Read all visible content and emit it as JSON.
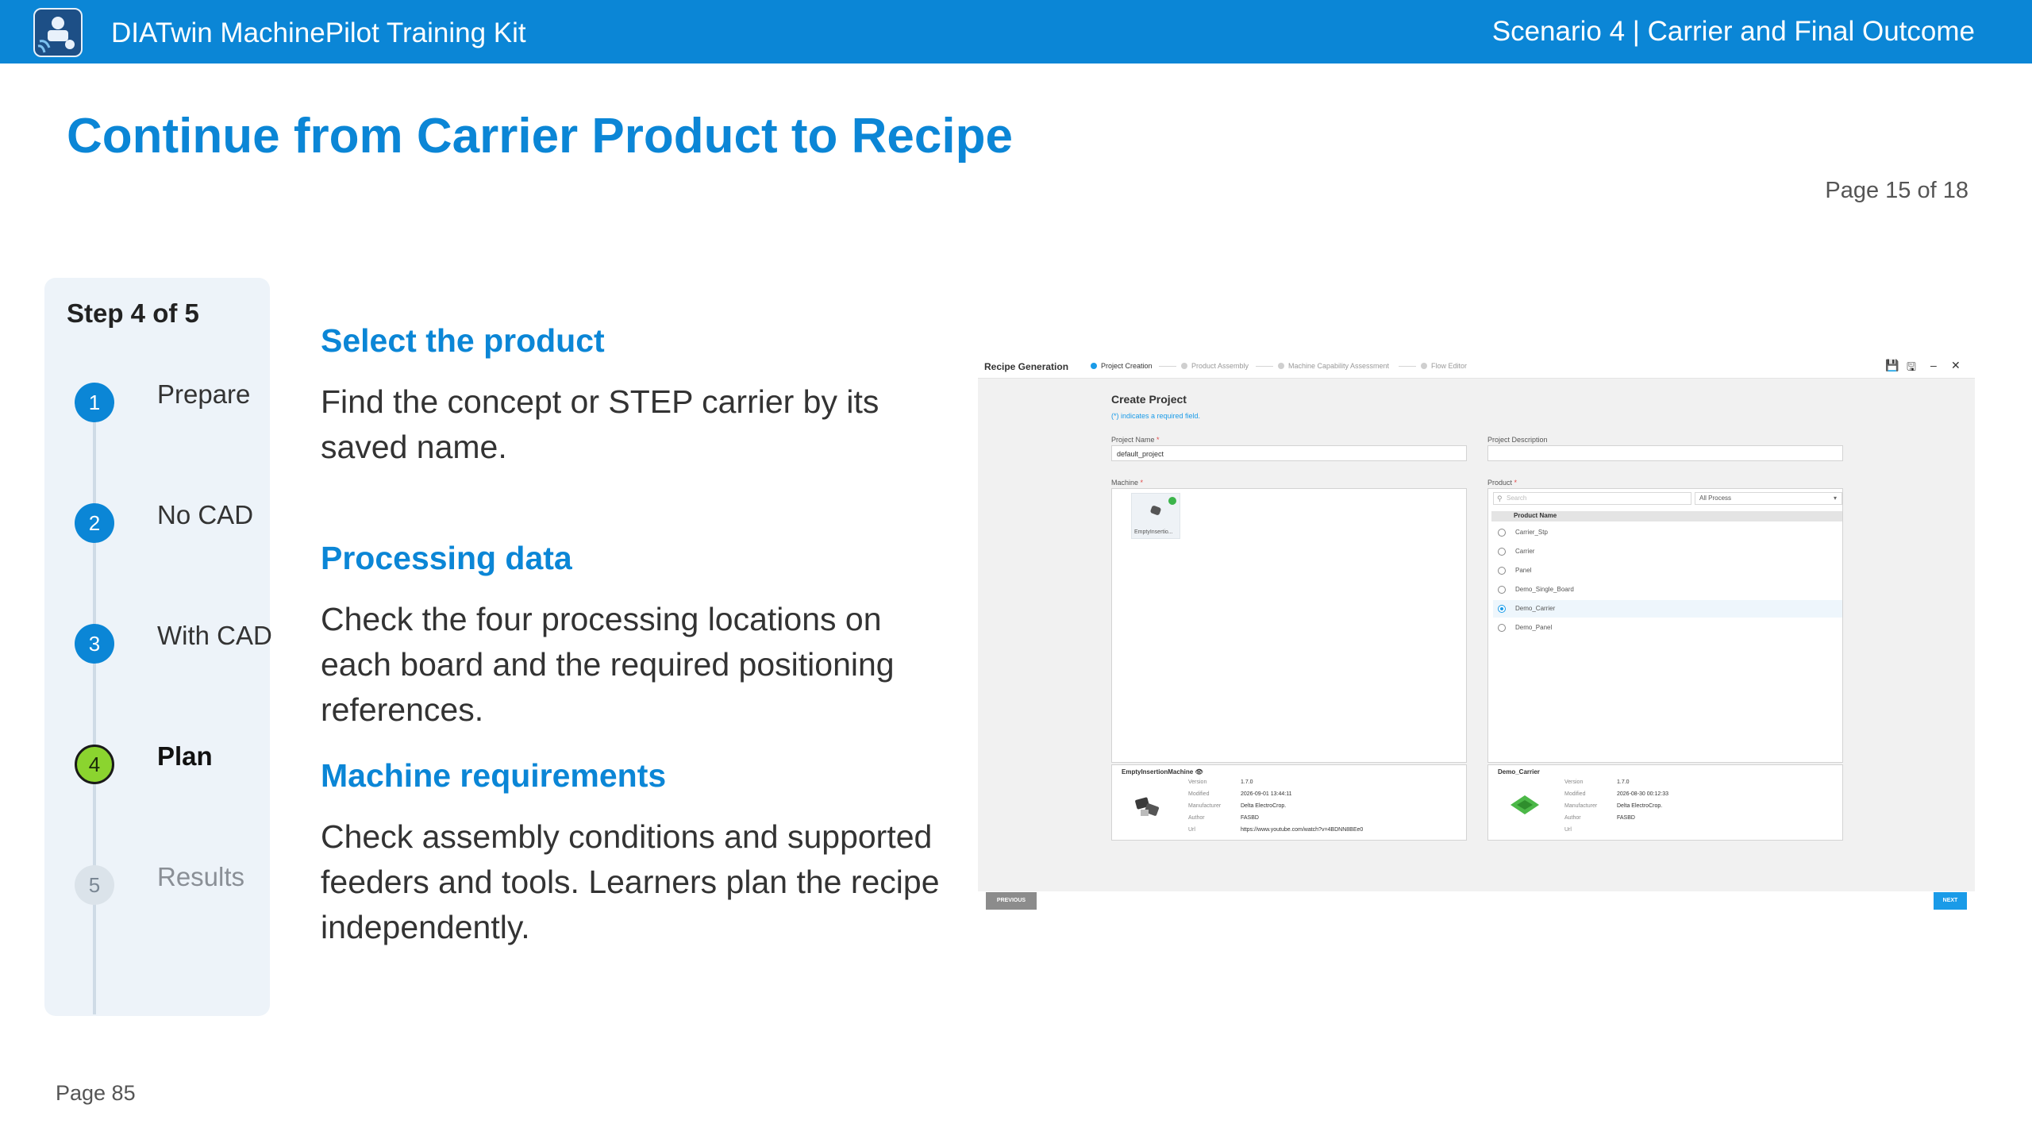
{
  "header": {
    "app_title": "DIATwin MachinePilot Training Kit",
    "scenario": "Scenario 4 | Carrier and Final Outcome"
  },
  "page": {
    "title": "Continue from Carrier Product to Recipe",
    "page_count": "Page 15 of 18",
    "footer_page": "Page 85"
  },
  "stepper": {
    "title": "Step 4 of 5",
    "steps": [
      {
        "num": "1",
        "label": "Prepare",
        "state": "done"
      },
      {
        "num": "2",
        "label": "No CAD",
        "state": "done"
      },
      {
        "num": "3",
        "label": "With CAD",
        "state": "done"
      },
      {
        "num": "4",
        "label": "Plan",
        "state": "current"
      },
      {
        "num": "5",
        "label": "Results",
        "state": "future"
      }
    ]
  },
  "sections": [
    {
      "heading": "Select the product",
      "text": "Find the concept or STEP carrier by its saved name."
    },
    {
      "heading": "Processing data",
      "text": "Check the four processing locations on each board and the required positioning references."
    },
    {
      "heading": "Machine requirements",
      "text": "Check assembly conditions and supported feeders and tools. Learners plan the recipe independently."
    }
  ],
  "screenshot": {
    "header_title": "Recipe Generation",
    "wizard_steps": [
      "Project Creation",
      "Product Assembly",
      "Machine Capability Assessment",
      "Flow Editor"
    ],
    "active_wizard_step": 0,
    "create_title": "Create Project",
    "required_note": "(*) indicates a required field.",
    "project_name_label": "Project Name",
    "project_name_value": "default_project",
    "project_desc_label": "Project Description",
    "machine_label": "Machine",
    "product_label": "Product",
    "machine_tile_name": "EmptyInsertio...",
    "search_placeholder": "Search",
    "process_filter": "All Process",
    "product_list_header": "Product Name",
    "products": [
      "Carrier_Stp",
      "Carrier",
      "Panel",
      "Demo_Single_Board",
      "Demo_Carrier",
      "Demo_Panel"
    ],
    "selected_product": "Demo_Carrier",
    "machine_info": {
      "name": "EmptyInsertionMachine",
      "version_label": "Version",
      "version": "1.7.0",
      "modified_label": "Modified",
      "modified": "2026-09-01 13:44:11",
      "manufacturer_label": "Manufacturer",
      "manufacturer": "Delta ElectroCrop.",
      "author_label": "Author",
      "author": "FASBD",
      "url_label": "Url",
      "url": "https://www.youtube.com/watch?v=4BDNN8BEe0"
    },
    "product_info": {
      "name": "Demo_Carrier",
      "version_label": "Version",
      "version": "1.7.0",
      "modified_label": "Modified",
      "modified": "2026-08-30 00:12:33",
      "manufacturer_label": "Manufacturer",
      "manufacturer": "Delta ElectroCrop.",
      "author_label": "Author",
      "author": "FASBD",
      "url_label": "Url"
    },
    "prev_button": "PREVIOUS",
    "next_button": "NEXT"
  },
  "colors": {
    "brand_blue": "#0b86d6",
    "current_step_green": "#8bd42f",
    "accent_blue": "#1a9be8"
  }
}
